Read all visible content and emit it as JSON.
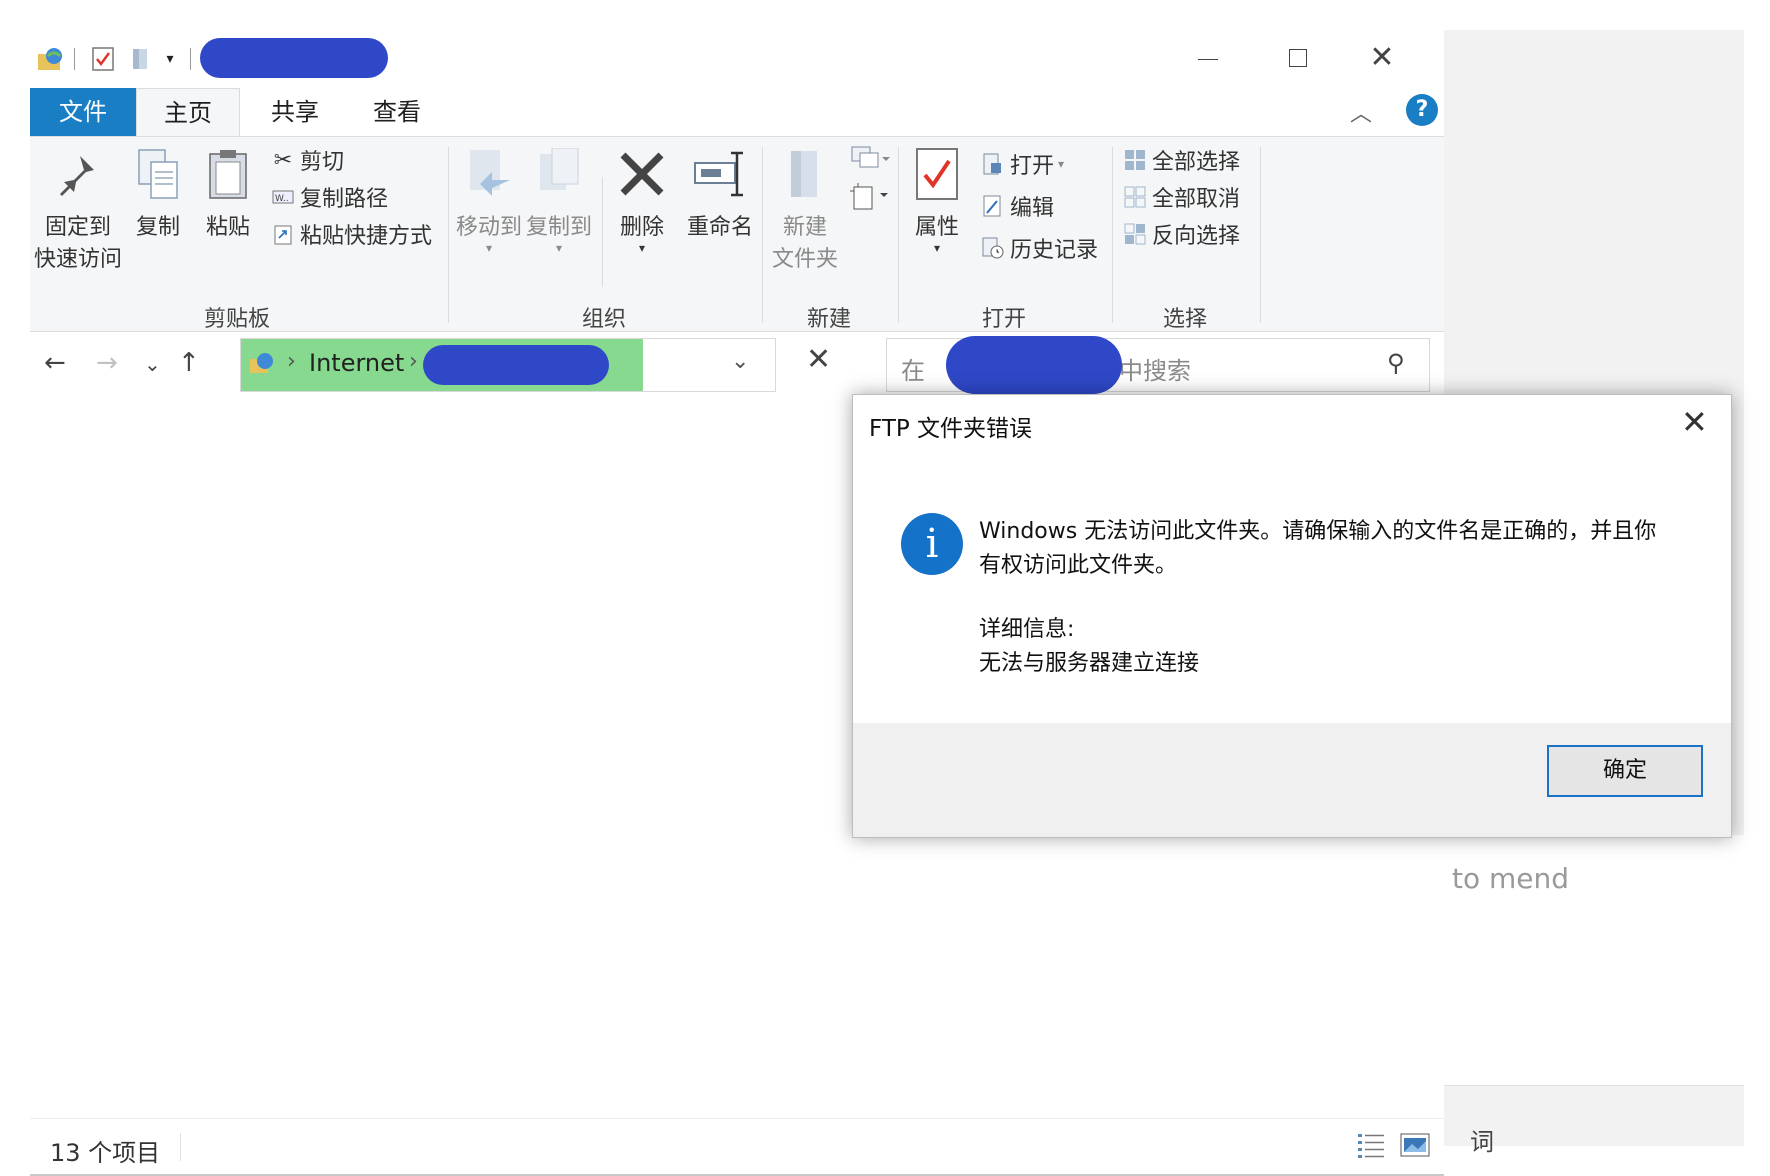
{
  "title_bar": {
    "quick_access": [
      "properties-icon",
      "new-folder-icon",
      "dropdown-icon"
    ]
  },
  "tabs": {
    "file": "文件",
    "home": "主页",
    "share": "共享",
    "view": "查看"
  },
  "ribbon": {
    "clipboard": {
      "pin_line1": "固定到",
      "pin_line2": "快速访问",
      "copy": "复制",
      "paste": "粘贴",
      "cut": "剪切",
      "copy_path": "复制路径",
      "paste_shortcut": "粘贴快捷方式",
      "group_label": "剪贴板"
    },
    "organize": {
      "move_to": "移动到",
      "copy_to": "复制到",
      "delete": "删除",
      "rename": "重命名",
      "group_label": "组织"
    },
    "new": {
      "new_folder_line1": "新建",
      "new_folder_line2": "文件夹",
      "group_label": "新建"
    },
    "open": {
      "properties": "属性",
      "open": "打开",
      "edit": "编辑",
      "history": "历史记录",
      "group_label": "打开"
    },
    "select": {
      "select_all": "全部选择",
      "select_none": "全部取消",
      "invert": "反向选择",
      "group_label": "选择"
    }
  },
  "address": {
    "segment": "Internet",
    "search_prefix": "在",
    "search_suffix": "中搜索"
  },
  "status": {
    "item_count": "13 个项目"
  },
  "background": {
    "text1": "to mend",
    "text2": "词"
  },
  "dialog": {
    "title": "FTP 文件夹错误",
    "message_line1": "Windows 无法访问此文件夹。请确保输入的文件名是正确的，并且你",
    "message_line2": "有权访问此文件夹。",
    "detail_label": "详细信息:",
    "detail_text": "无法与服务器建立连接",
    "ok": "确定"
  },
  "colors": {
    "accent": "#1a7ec4",
    "address_highlight": "#86d98e",
    "redaction": "#2e48c8",
    "dialog_button_border": "#1a73c8"
  }
}
